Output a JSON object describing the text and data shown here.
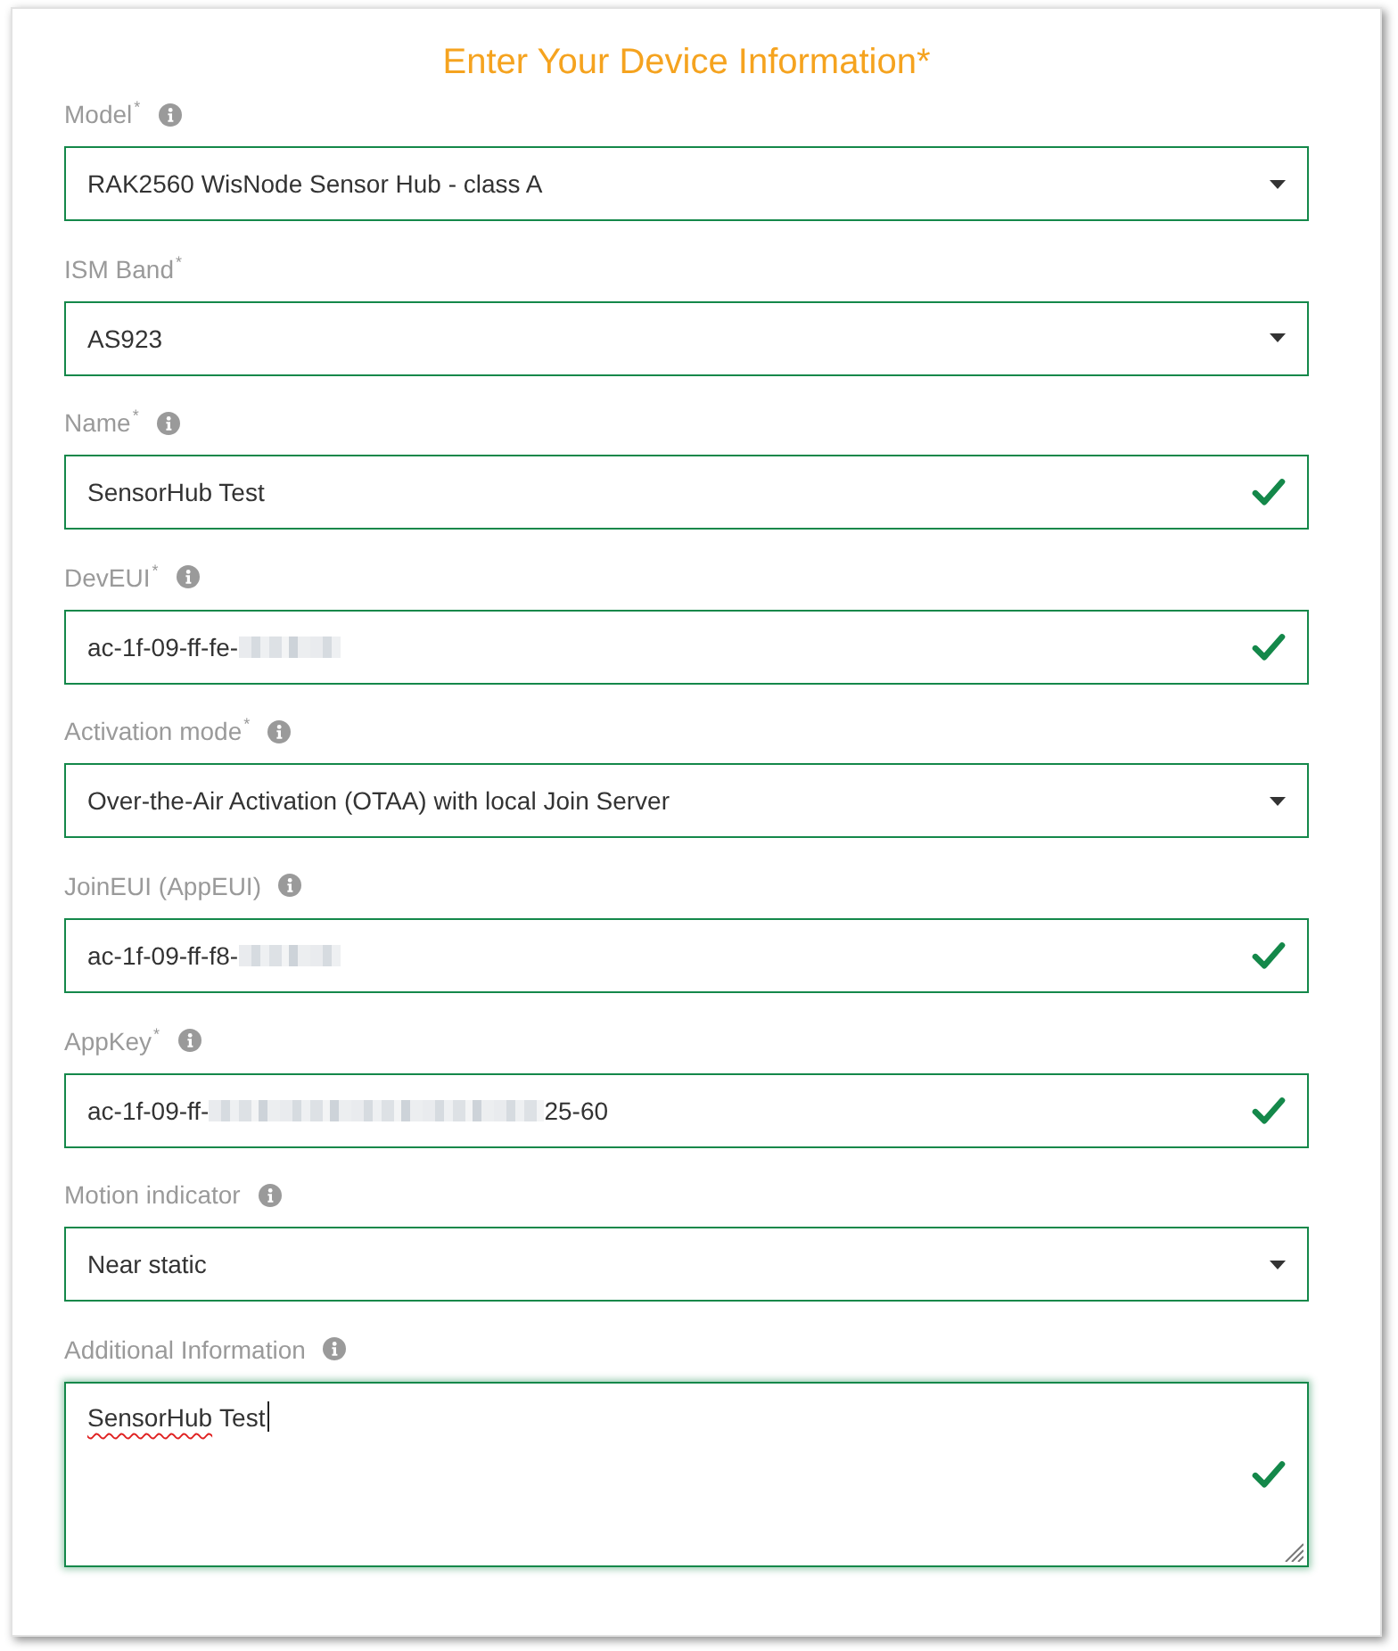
{
  "form": {
    "title": "Enter Your Device Information*",
    "fields": [
      {
        "kind": "select",
        "label": "Model$^{*}$",
        "info": true,
        "valid": false,
        "focused": false,
        "value": [
          {
            "kind": "text",
            "text": "RAK2560 WisNode Sensor Hub - class A"
          }
        ]
      },
      {
        "kind": "select",
        "label": "ISM Band$^{*}$",
        "info": false,
        "valid": false,
        "focused": false,
        "value": [
          {
            "kind": "text",
            "text": "AS923"
          }
        ]
      },
      {
        "kind": "text",
        "label": "Name$^{*}$",
        "info": true,
        "valid": true,
        "focused": false,
        "value": [
          {
            "kind": "text",
            "text": "SensorHub Test"
          }
        ]
      },
      {
        "kind": "text",
        "label": "DevEUI$^{*}$",
        "info": true,
        "valid": true,
        "focused": false,
        "value": [
          {
            "kind": "text",
            "text": "ac-1f-09-ff-fe-"
          },
          {
            "kind": "redacted"
          }
        ]
      },
      {
        "kind": "select",
        "label": "Activation mode$^{*}$",
        "info": true,
        "valid": false,
        "focused": false,
        "value": [
          {
            "kind": "text",
            "text": "Over-the-Air Activation (OTAA) with local Join Server"
          }
        ]
      },
      {
        "kind": "text",
        "label": "JoinEUI (AppEUI)",
        "info": true,
        "valid": true,
        "focused": false,
        "value": [
          {
            "kind": "text",
            "text": "ac-1f-09-ff-f8-"
          },
          {
            "kind": "redacted"
          }
        ]
      },
      {
        "kind": "text",
        "label": "AppKey$^{*}$",
        "info": true,
        "valid": true,
        "focused": false,
        "value": [
          {
            "kind": "text",
            "text": "ac-1f-09-ff-"
          },
          {
            "kind": "redacted"
          },
          {
            "kind": "text",
            "text": "25-60"
          }
        ]
      },
      {
        "kind": "select",
        "label": "Motion indicator",
        "info": true,
        "valid": false,
        "focused": false,
        "value": [
          {
            "kind": "text",
            "text": "Near static"
          }
        ]
      },
      {
        "kind": "textarea",
        "label": "Additional Information",
        "info": true,
        "valid": true,
        "focused": true,
        "value": [
          {
            "kind": "text",
            "text": "SensorHub",
            "misspelled": true
          },
          {
            "kind": "text",
            "text": "Test",
            "misspelled": false
          }
        ]
      }
    ]
  }
}
